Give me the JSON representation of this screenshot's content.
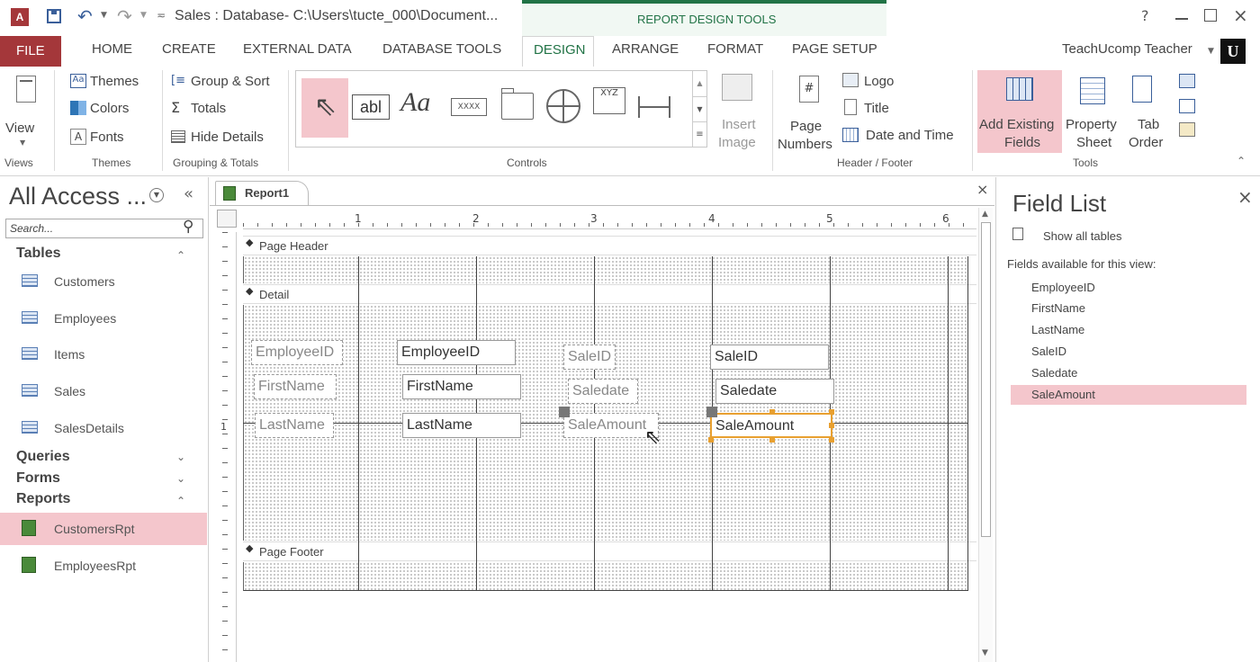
{
  "titlebar": {
    "app_icon": "A",
    "title": "Sales : Database- C:\\Users\\tucte_000\\Document...",
    "context_group": "REPORT DESIGN TOOLS",
    "help": "?",
    "user": "TeachUcomp Teacher"
  },
  "tabs": [
    {
      "label": "FILE"
    },
    {
      "label": "HOME"
    },
    {
      "label": "CREATE"
    },
    {
      "label": "EXTERNAL DATA"
    },
    {
      "label": "DATABASE TOOLS"
    },
    {
      "label": "DESIGN"
    },
    {
      "label": "ARRANGE"
    },
    {
      "label": "FORMAT"
    },
    {
      "label": "PAGE SETUP"
    }
  ],
  "ribbon": {
    "views": {
      "view": "View",
      "label": "Views"
    },
    "themes": {
      "themes": "Themes",
      "colors": "Colors",
      "fonts": "Fonts",
      "label": "Themes"
    },
    "grouping": {
      "group_sort": "Group & Sort",
      "totals": "Totals",
      "hide_details": "Hide Details",
      "label": "Grouping & Totals"
    },
    "controls": {
      "label": "Controls",
      "textbox": "abl",
      "label_ctl": "Aa",
      "button": "XXXX",
      "hyperlink": "XYZ"
    },
    "insert_image": {
      "line1": "Insert",
      "line2": "Image"
    },
    "header_footer": {
      "page_numbers_1": "Page",
      "page_numbers_2": "Numbers",
      "page_num_glyph": "#",
      "logo": "Logo",
      "title": "Title",
      "date_time": "Date and Time",
      "label": "Header / Footer"
    },
    "tools": {
      "add_fields_1": "Add Existing",
      "add_fields_2": "Fields",
      "property_1": "Property",
      "property_2": "Sheet",
      "tab_1": "Tab",
      "tab_2": "Order",
      "label": "Tools"
    }
  },
  "nav": {
    "title": "All Access ...",
    "search_placeholder": "Search...",
    "tables_header": "Tables",
    "tables": [
      "Customers",
      "Employees",
      "Items",
      "Sales",
      "SalesDetails"
    ],
    "queries_header": "Queries",
    "forms_header": "Forms",
    "reports_header": "Reports",
    "reports": [
      "CustomersRpt",
      "EmployeesRpt"
    ]
  },
  "document": {
    "tab_label": "Report1",
    "ruler_numbers": [
      "1",
      "2",
      "3",
      "4",
      "5",
      "6"
    ],
    "vruler_mark": "1",
    "sections": {
      "page_header": "Page Header",
      "detail": "Detail",
      "page_footer": "Page Footer"
    },
    "controls": {
      "lbl_employeeid": "EmployeeID",
      "txt_employeeid": "EmployeeID",
      "lbl_firstname": "FirstName",
      "txt_firstname": "FirstName",
      "lbl_lastname": "LastName",
      "txt_lastname": "LastName",
      "lbl_saleid": "SaleID",
      "txt_saleid": "SaleID",
      "lbl_saledate": "Saledate",
      "txt_saledate": "Saledate",
      "lbl_saleamount": "SaleAmount",
      "txt_saleamount": "SaleAmount"
    }
  },
  "fieldlist": {
    "title": "Field List",
    "show_all": "Show all tables",
    "available": "Fields available for this view:",
    "fields": [
      "EmployeeID",
      "FirstName",
      "LastName",
      "SaleID",
      "Saledate",
      "SaleAmount"
    ],
    "selected_field": "SaleAmount"
  },
  "colors": {
    "accent": "#a4373a",
    "selected": "#f4c6cc",
    "context": "#217346",
    "selection_handle": "#e8a030"
  }
}
